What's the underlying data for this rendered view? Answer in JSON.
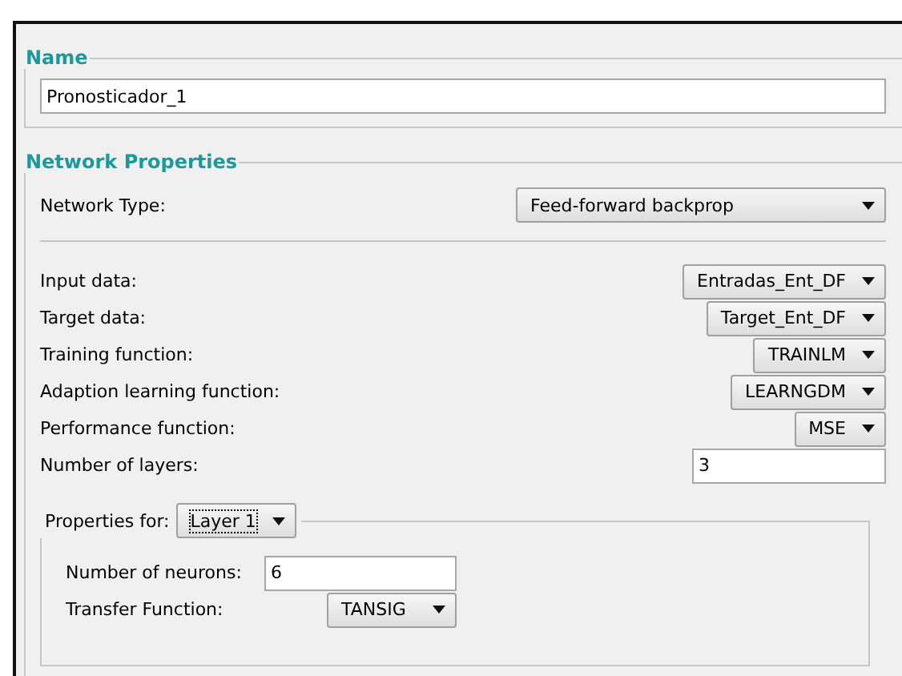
{
  "name_group": {
    "title": "Name",
    "value": "Pronosticador_1"
  },
  "network_properties": {
    "title": "Network Properties",
    "network_type": {
      "label": "Network Type:",
      "value": "Feed-forward backprop"
    },
    "rows": [
      {
        "kind": "dropdown",
        "label": "Input data:",
        "value": "Entradas_Ent_DF"
      },
      {
        "kind": "dropdown",
        "label": "Target data:",
        "value": "Target_Ent_DF"
      },
      {
        "kind": "dropdown",
        "label": "Training function:",
        "value": "TRAINLM"
      },
      {
        "kind": "dropdown",
        "label": "Adaption learning function:",
        "value": "LEARNGDM"
      },
      {
        "kind": "dropdown",
        "label": "Performance function:",
        "value": "MSE"
      },
      {
        "kind": "field",
        "label": "Number of layers:",
        "value": "3"
      }
    ],
    "layer_properties": {
      "label": "Properties for:",
      "layer": {
        "value": "Layer 1",
        "focused": true
      },
      "rows": [
        {
          "kind": "field",
          "label": "Number of neurons:",
          "value": "6"
        },
        {
          "kind": "dropdown",
          "label": "Transfer Function:",
          "value": "TANSIG"
        }
      ]
    }
  }
}
